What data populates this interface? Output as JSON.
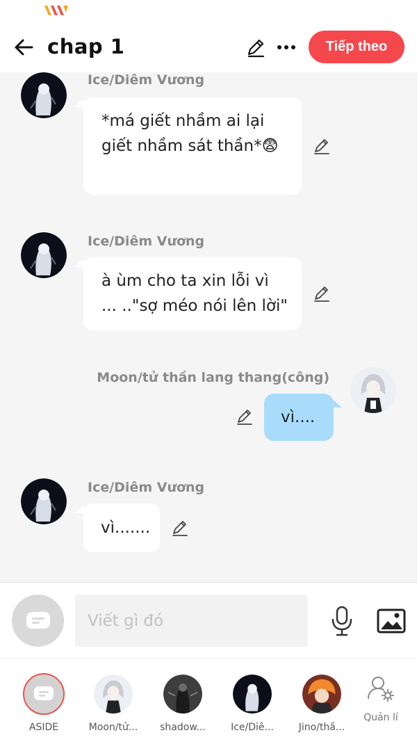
{
  "status_bar": {
    "carrier_logo": "viettel-logo-icon"
  },
  "header": {
    "back_icon": "arrow-left-icon",
    "title": "chap 1",
    "edit_icon": "pencil-icon",
    "more_icon": "more-dots-icon",
    "next_label": "Tiếp theo",
    "accent_color": "#f5484d"
  },
  "messages": [
    {
      "side": "left",
      "sender": "Ice/Diêm Vương",
      "text": "*má giết nhầm ai lại giết nhầm sát thần*😨",
      "avatar": "dark-character-avatar"
    },
    {
      "side": "left",
      "sender": "Ice/Diêm Vương",
      "text": "à ùm cho ta xin lỗi vì ... ..\"sợ méo nói lên lời\"",
      "avatar": "dark-character-avatar"
    },
    {
      "side": "right",
      "sender": "Moon/tử thần lang thang(công)",
      "text": "vì....",
      "avatar": "white-hair-character-avatar"
    },
    {
      "side": "left",
      "sender": "Ice/Diêm Vương",
      "text": "vì.......",
      "avatar": "dark-character-avatar"
    }
  ],
  "composer": {
    "aside_icon": "chat-bubble-icon",
    "placeholder": "Viết gì đó",
    "mic_icon": "microphone-icon",
    "image_icon": "image-icon"
  },
  "characters": [
    {
      "label": "ASIDE",
      "avatar": "chat-bubble-icon"
    },
    {
      "label": "Moon/tử...",
      "avatar": "white-hair-character-avatar"
    },
    {
      "label": "shadow...",
      "avatar": "shadow-character-avatar"
    },
    {
      "label": "Ice/Diê...",
      "avatar": "dark-character-avatar"
    },
    {
      "label": "Jino/thầ...",
      "avatar": "orange-hair-character-avatar"
    }
  ],
  "manage": {
    "label": "Quản lí",
    "icon": "user-settings-icon"
  },
  "colors": {
    "right_bubble": "#a9dcfb",
    "left_bubble": "#ffffff",
    "background": "#f5f5f5"
  }
}
